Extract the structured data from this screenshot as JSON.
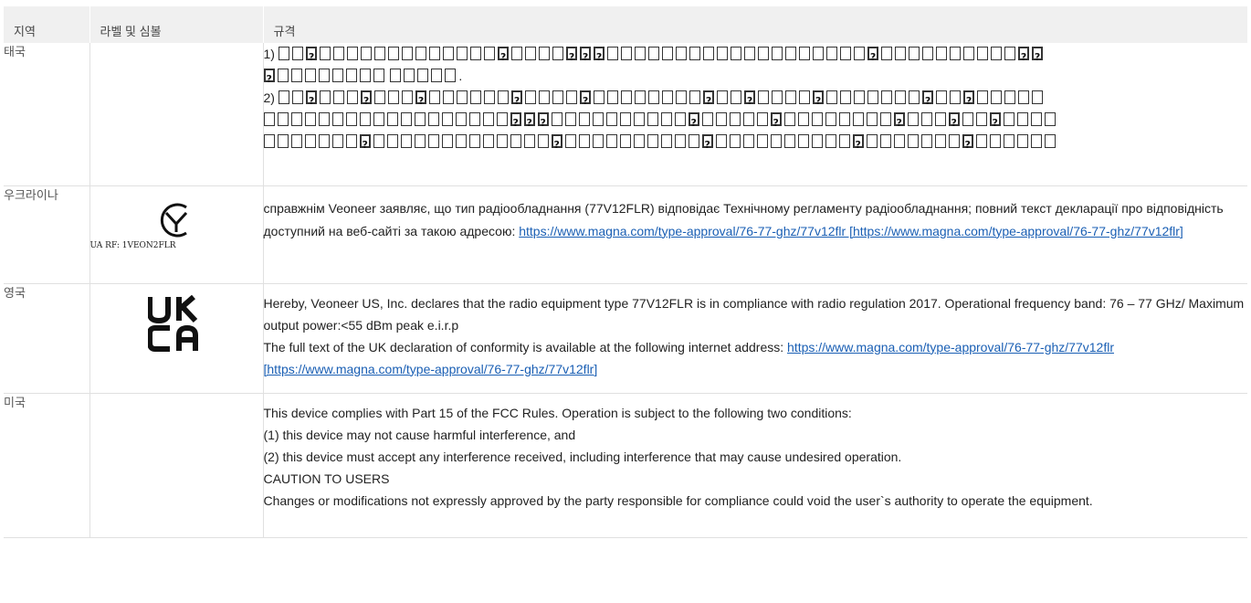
{
  "headers": {
    "region": "지역",
    "label": "라벨 및 심볼",
    "spec": "규격"
  },
  "rows": {
    "thailand": {
      "region": "태국",
      "line1_prefix": "1) ",
      "line1_suffix": ".",
      "line2_prefix": "2) "
    },
    "ukraine": {
      "region": "우크라이나",
      "logo_caption": "UA RF: 1VEON2FLR",
      "text": "справжнім Veoneer заявляє, що тип радіообладнання (77V12FLR) відповідає Технічному регламенту радіообладнання; повний текст декларації про відповідність доступний на веб-сайті за такою адресою: ",
      "link": "https://www.magna.com/type-approval/76-77-ghz/77v12flr [https://www.magna.com/type-approval/76-77-ghz/77v12flr]"
    },
    "uk": {
      "region": "영국",
      "logo_top": "UK",
      "logo_bottom": "CA",
      "line1": "Hereby, Veoneer US, Inc. declares that the radio equipment type 77V12FLR is in compliance with radio regulation 2017. Operational frequency band: 76 – 77 GHz/ Maximum output power:<55 dBm peak e.i.r.p",
      "line2": "The full text of the UK declaration of conformity is available at the following internet address: ",
      "link": "https://www.magna.com/type-approval/76-77-ghz/77v12flr [https://www.magna.com/type-approval/76-77-ghz/77v12flr]"
    },
    "usa": {
      "region": "미국",
      "lines": [
        "This device complies with Part 15 of the FCC Rules. Operation is subject to the following two conditions:",
        "(1) this device may not cause harmful interference, and",
        "(2) this device must accept any interference received, including interference that may cause undesired operation.",
        "CAUTION TO USERS",
        "Changes or modifications not expressly approved by the party responsible for compliance could void the user`s authority to operate the equipment."
      ]
    }
  }
}
